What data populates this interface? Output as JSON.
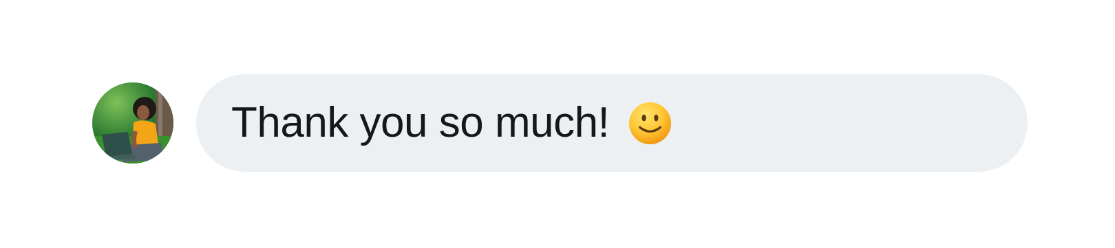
{
  "message": {
    "avatar_icon": "user-avatar-photo",
    "text": "Thank you so much!",
    "emoji_icon": "slightly-smiling-face-emoji",
    "bubble_color": "#ecf0f3",
    "text_color": "#15171a"
  }
}
